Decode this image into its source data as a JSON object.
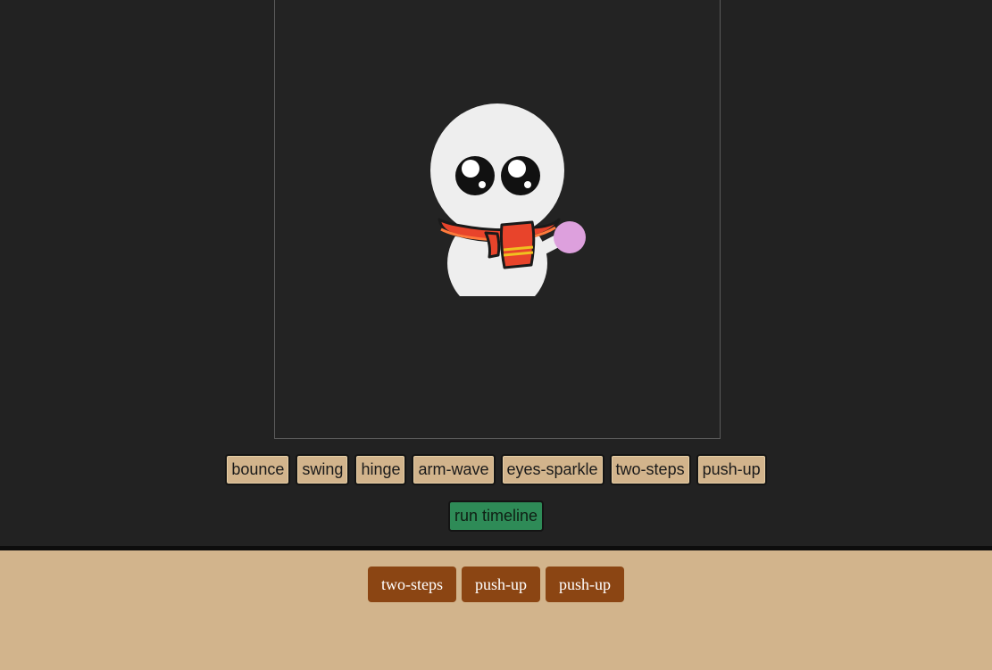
{
  "animations": [
    {
      "label": "bounce"
    },
    {
      "label": "swing"
    },
    {
      "label": "hinge"
    },
    {
      "label": "arm-wave"
    },
    {
      "label": "eyes-sparkle"
    },
    {
      "label": "two-steps"
    },
    {
      "label": "push-up"
    }
  ],
  "run_button": {
    "label": "run timeline"
  },
  "timeline": {
    "items": [
      {
        "label": "two-steps"
      },
      {
        "label": "push-up"
      },
      {
        "label": "push-up"
      }
    ]
  },
  "colors": {
    "page_background": "#222222",
    "stage_background": "#232323",
    "animation_button": "#d2b48c",
    "run_button": "#2e8b57",
    "timeline_background": "#d2b48c",
    "timeline_chip": "#8b4513",
    "snowman_body": "#eeeeee",
    "scarf": "#e8442b",
    "scarf_stripe": "#f0c020",
    "hand": "#dda0dd"
  }
}
